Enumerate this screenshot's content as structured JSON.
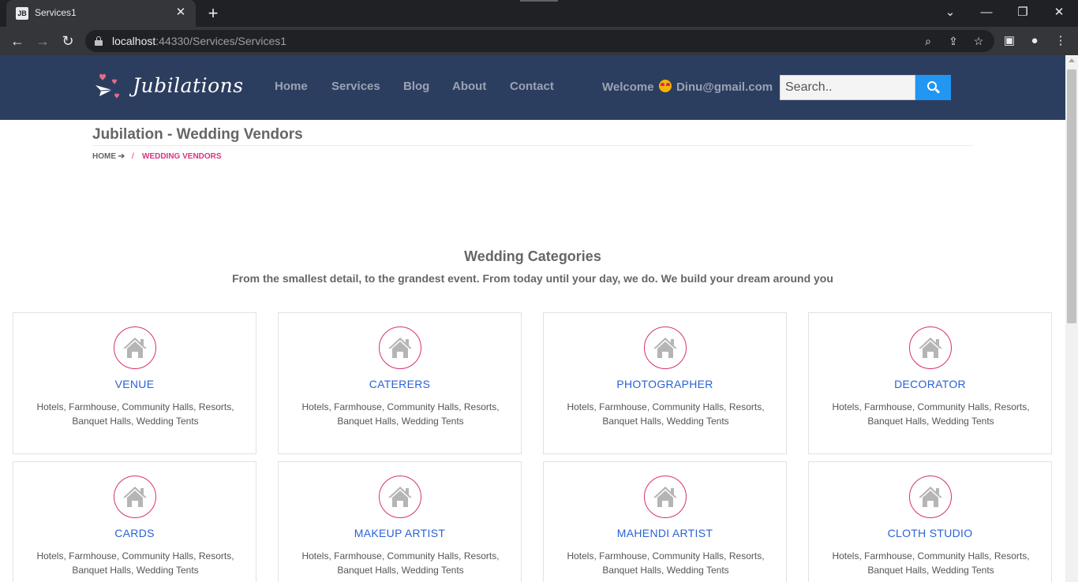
{
  "browser": {
    "tab_title": "Services1",
    "favicon_text": "JB",
    "url_host": "localhost",
    "url_path": ":44330/Services/Services1"
  },
  "header": {
    "logo_text": "Jubilations",
    "nav": [
      "Home",
      "Services",
      "Blog",
      "About",
      "Contact"
    ],
    "welcome_prefix": "Welcome",
    "welcome_user": "Dinu@gmail.com",
    "search_placeholder": "Search.."
  },
  "page": {
    "title": "Jubilation - Wedding Vendors",
    "breadcrumb": {
      "home": "HOME",
      "separator": "/",
      "current": "WEDDING VENDORS"
    }
  },
  "section": {
    "title": "Wedding Categories",
    "subtitle": "From the smallest detail, to the grandest event. From today until your day, we do. We build your dream around you"
  },
  "categories": [
    {
      "title": "VENUE",
      "desc": "Hotels, Farmhouse, Community Halls, Resorts, Banquet Halls, Wedding Tents"
    },
    {
      "title": "CATERERS",
      "desc": "Hotels, Farmhouse, Community Halls, Resorts, Banquet Halls, Wedding Tents"
    },
    {
      "title": "PHOTOGRAPHER",
      "desc": "Hotels, Farmhouse, Community Halls, Resorts, Banquet Halls, Wedding Tents"
    },
    {
      "title": "DECORATOR",
      "desc": "Hotels, Farmhouse, Community Halls, Resorts, Banquet Halls, Wedding Tents"
    },
    {
      "title": "CARDS",
      "desc": "Hotels, Farmhouse, Community Halls, Resorts, Banquet Halls, Wedding Tents"
    },
    {
      "title": "MAKEUP ARTIST",
      "desc": "Hotels, Farmhouse, Community Halls, Resorts, Banquet Halls, Wedding Tents"
    },
    {
      "title": "MAHENDI ARTIST",
      "desc": "Hotels, Farmhouse, Community Halls, Resorts, Banquet Halls, Wedding Tents"
    },
    {
      "title": "CLOTH STUDIO",
      "desc": "Hotels, Farmhouse, Community Halls, Resorts, Banquet Halls, Wedding Tents"
    }
  ],
  "colors": {
    "header_bg": "#2c3e5f",
    "accent_pink": "#d6336c",
    "link_blue": "#2962d6",
    "search_button": "#2196f3"
  },
  "icons": {
    "card_icon": "home-icon",
    "search": "search-icon"
  }
}
